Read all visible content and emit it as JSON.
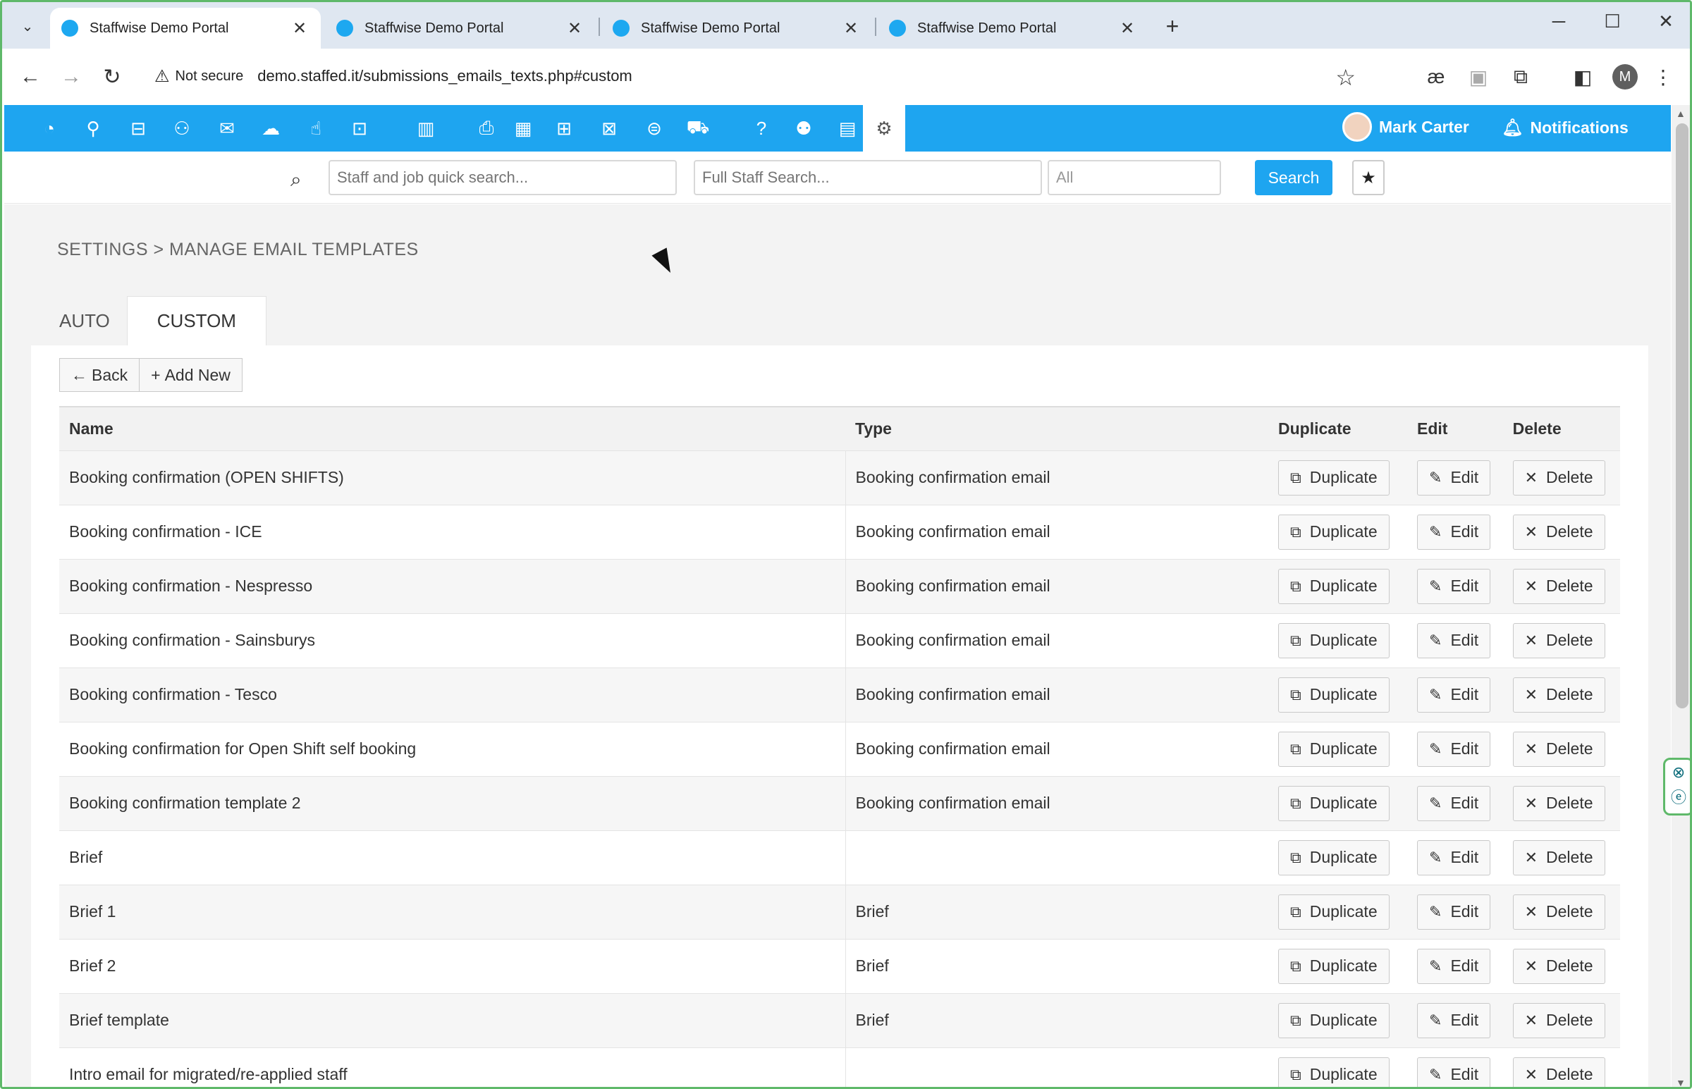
{
  "browser": {
    "tabs": [
      {
        "title": "Staffwise Demo Portal"
      },
      {
        "title": "Staffwise Demo Portal"
      },
      {
        "title": "Staffwise Demo Portal"
      },
      {
        "title": "Staffwise Demo Portal"
      }
    ],
    "security_label": "Not secure",
    "url": "demo.staffed.it/submissions_emails_texts.php#custom",
    "profile_initial": "M"
  },
  "appbar": {
    "user_name": "Mark Carter",
    "notifications_label": "Notifications"
  },
  "search": {
    "quick_placeholder": "Staff and job quick search...",
    "full_placeholder": "Full Staff Search...",
    "filter_value": "All",
    "button_label": "Search"
  },
  "page": {
    "breadcrumb": "SETTINGS > MANAGE EMAIL TEMPLATES",
    "tabs": [
      {
        "label": "AUTO"
      },
      {
        "label": "CUSTOM"
      }
    ],
    "back_label": "Back",
    "add_new_label": "Add New"
  },
  "table": {
    "headers": {
      "name": "Name",
      "type": "Type",
      "duplicate": "Duplicate",
      "edit": "Edit",
      "delete": "Delete"
    },
    "action_labels": {
      "duplicate": "Duplicate",
      "edit": "Edit",
      "delete": "Delete"
    },
    "rows": [
      {
        "name": "Booking confirmation (OPEN SHIFTS)",
        "type": "Booking confirmation email"
      },
      {
        "name": "Booking confirmation - ICE",
        "type": "Booking confirmation email"
      },
      {
        "name": "Booking confirmation - Nespresso",
        "type": "Booking confirmation email"
      },
      {
        "name": "Booking confirmation - Sainsburys",
        "type": "Booking confirmation email"
      },
      {
        "name": "Booking confirmation - Tesco",
        "type": "Booking confirmation email"
      },
      {
        "name": "Booking confirmation for Open Shift self booking",
        "type": "Booking confirmation email"
      },
      {
        "name": "Booking confirmation template 2",
        "type": "Booking confirmation email"
      },
      {
        "name": "Brief",
        "type": ""
      },
      {
        "name": "Brief 1",
        "type": "Brief"
      },
      {
        "name": "Brief 2",
        "type": "Brief"
      },
      {
        "name": "Brief template",
        "type": "Brief"
      },
      {
        "name": "Intro email for migrated/re-applied staff",
        "type": ""
      }
    ]
  },
  "colors": {
    "brand_blue": "#1ea5f0",
    "frame_green": "#5fb96a"
  }
}
